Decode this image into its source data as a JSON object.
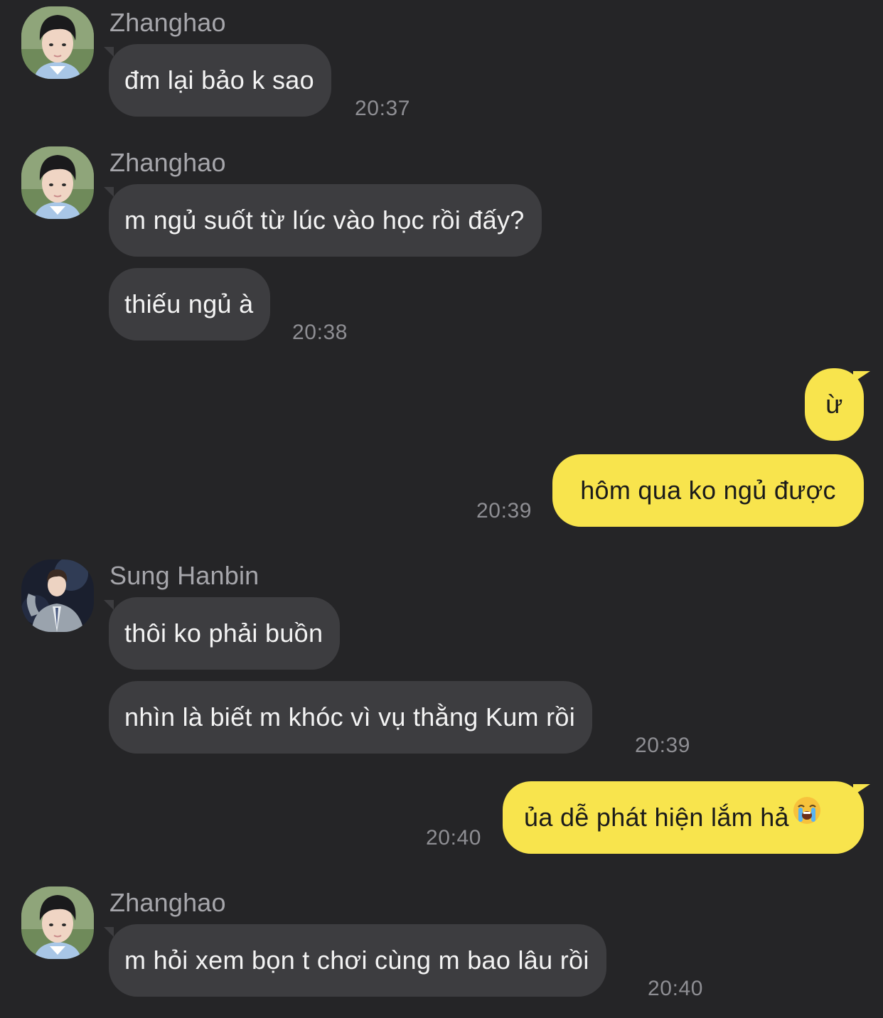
{
  "messages": [
    {
      "sender": "Zhanghao",
      "text": "đm lại bảo k sao",
      "time": "20:37"
    },
    {
      "sender": "Zhanghao",
      "text": "m ngủ suốt từ lúc vào học rồi đấy?"
    },
    {
      "text": "thiếu ngủ à",
      "time": "20:38"
    },
    {
      "text": "ừ"
    },
    {
      "text": "hôm qua ko ngủ được",
      "time": "20:39"
    },
    {
      "sender": "Sung Hanbin",
      "text": "thôi ko phải buồn"
    },
    {
      "text": "nhìn là biết m khóc vì vụ thằng Kum rồi",
      "time": "20:39"
    },
    {
      "text": "ủa dễ phát hiện lắm hả",
      "time": "20:40"
    },
    {
      "sender": "Zhanghao",
      "text": "m hỏi xem bọn t chơi cùng m bao lâu rồi",
      "time": "20:40"
    }
  ],
  "icons": {
    "emoji": "loudly-crying-face-emoji"
  },
  "colors": {
    "background": "#252527",
    "incoming_bubble": "#3d3d40",
    "outgoing_bubble": "#f8e44d",
    "sender_name": "#a6a6ab",
    "timestamp": "#8e8e93"
  }
}
